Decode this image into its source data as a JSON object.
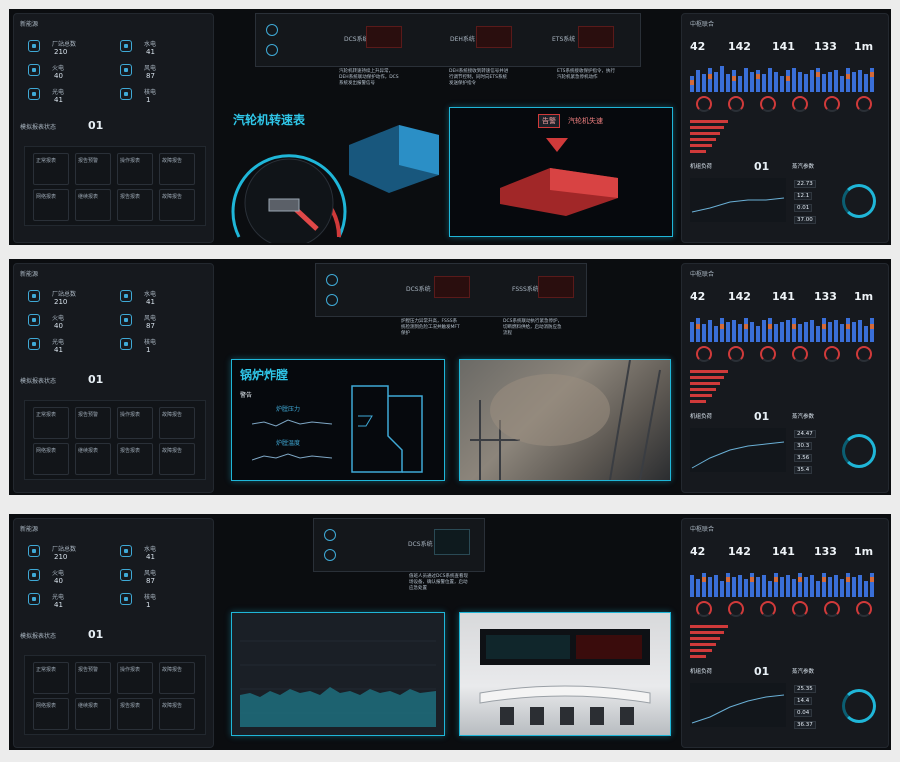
{
  "left_panel": {
    "title": "新能源",
    "counts": [
      {
        "label": "厂站总数",
        "value": "210",
        "icon": "factory-icon"
      },
      {
        "label": "水电",
        "value": "41",
        "icon": "hydro-icon"
      },
      {
        "label": "火电",
        "value": "40",
        "icon": "thermal-icon"
      },
      {
        "label": "风电",
        "value": "87",
        "icon": "wind-icon"
      },
      {
        "label": "光电",
        "value": "41",
        "icon": "solar-icon"
      },
      {
        "label": "核电",
        "value": "1",
        "icon": "nuclear-icon"
      }
    ],
    "section_label": "模拟报表状态",
    "section_value": "01",
    "tiles": [
      "正常报表",
      "报告预警",
      "操作报表",
      "故障报告",
      "网络报表",
      "继续报表",
      "报告报表",
      "故障报告"
    ]
  },
  "right_panel": {
    "title": "中枢联合",
    "kpis": [
      "42",
      "142",
      "141",
      "133",
      "1m"
    ],
    "section_a": "机组负荷",
    "section_a_value": "01",
    "section_b": "蒸汽参数",
    "stats_strip1": [
      "22.73",
      "12.1",
      "0.01",
      "37.00"
    ],
    "stats_strip2": [
      "24.47",
      "30.3",
      "3.56",
      "35.4"
    ],
    "stats_strip3": [
      "25.35",
      "14.4",
      "0.04",
      "36.37"
    ]
  },
  "strip1": {
    "heading": "汽轮机转速表",
    "dcs_labels": [
      "DCS系统",
      "DEH系统",
      "ETS系统"
    ],
    "alert_tag": "告警",
    "alert_text": "汽轮机失速",
    "notes": [
      "汽轮机转速持续上升异常，DEH系统联动保护动作，DCS系统发出报警信号",
      "DEH系统接收到转速信号并进行调节控制，同时向ETS系统发送保护指令",
      "ETS系统接收保护指令，执行汽轮机紧急停机动作"
    ]
  },
  "strip2": {
    "heading": "锅炉炸膛",
    "dcs_labels": [
      "DCS系统",
      "FSSS系统"
    ],
    "notes": [
      "炉膛压力异常升高，FSSS系统检测到危险工况并触发MFT保护",
      "DCS系统联动执行紧急停炉，切断燃料供给，启动消防应急流程"
    ],
    "chart_labels": [
      "炉膛压力",
      "炉膛温度"
    ],
    "side_label": "警告"
  },
  "strip3": {
    "dcs_label": "DCS系统",
    "notes": [
      "值班人员通过DCS系统查看现场设备，确认报警位置，启动应急处置"
    ]
  },
  "colors": {
    "accent": "#1fb6d8",
    "alarm": "#d03a3a",
    "panel": "#16191e",
    "bg": "#0b0d10"
  }
}
